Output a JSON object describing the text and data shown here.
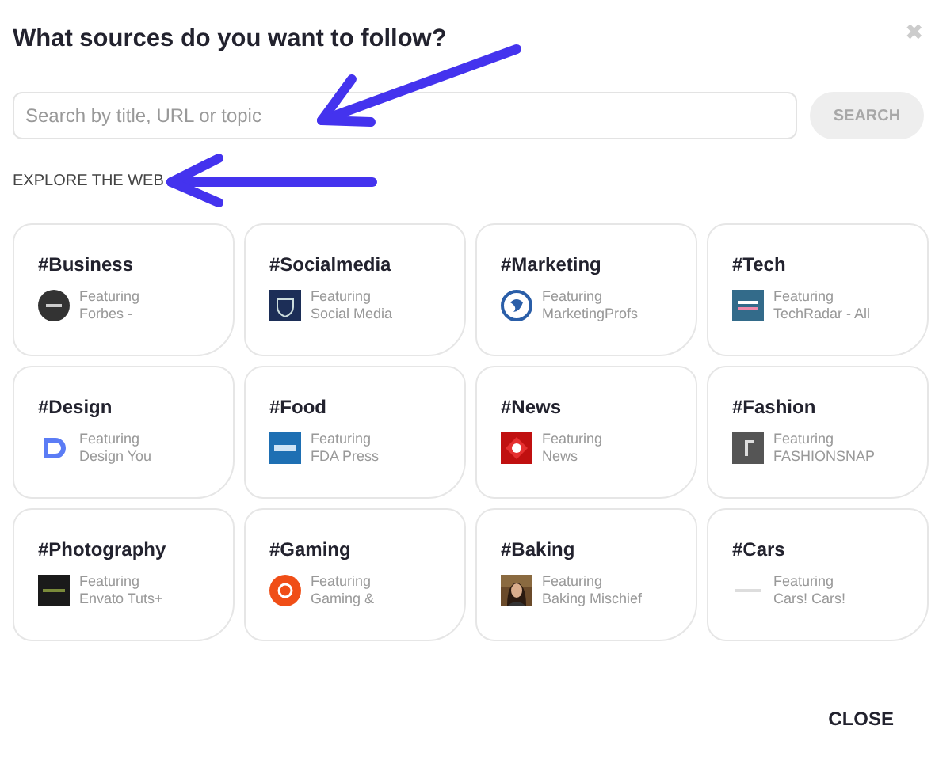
{
  "dialog": {
    "title": "What sources do you want to follow?",
    "close_icon": "✖"
  },
  "search": {
    "placeholder": "Search by title, URL or topic",
    "button": "SEARCH",
    "button_disabled": true
  },
  "section_label": "EXPLORE THE WEB",
  "topics": [
    {
      "tag": "#Business",
      "featuring": "Featuring",
      "source": "Forbes -",
      "logo": {
        "kind": "circle-dark"
      }
    },
    {
      "tag": "#Socialmedia",
      "featuring": "Featuring",
      "source": "Social Media",
      "logo": {
        "kind": "navy-shield"
      }
    },
    {
      "tag": "#Marketing",
      "featuring": "Featuring",
      "source": "MarketingProfs",
      "logo": {
        "kind": "globe"
      }
    },
    {
      "tag": "#Tech",
      "featuring": "Featuring",
      "source": "TechRadar - All",
      "logo": {
        "kind": "teal-square"
      }
    },
    {
      "tag": "#Design",
      "featuring": "Featuring",
      "source": "Design You",
      "logo": {
        "kind": "blue-d"
      }
    },
    {
      "tag": "#Food",
      "featuring": "Featuring",
      "source": "FDA Press",
      "logo": {
        "kind": "blue-square"
      }
    },
    {
      "tag": "#News",
      "featuring": "Featuring",
      "source": "News",
      "logo": {
        "kind": "red-diamond"
      }
    },
    {
      "tag": "#Fashion",
      "featuring": "Featuring",
      "source": "FASHIONSNAP",
      "logo": {
        "kind": "grey-square"
      }
    },
    {
      "tag": "#Photography",
      "featuring": "Featuring",
      "source": "Envato Tuts+",
      "logo": {
        "kind": "black-square"
      }
    },
    {
      "tag": "#Gaming",
      "featuring": "Featuring",
      "source": "Gaming &",
      "logo": {
        "kind": "orange-circle"
      }
    },
    {
      "tag": "#Baking",
      "featuring": "Featuring",
      "source": "Baking Mischief"
    },
    {
      "tag": "#Cars",
      "featuring": "Featuring",
      "source": "Cars! Cars!",
      "logo": {
        "kind": "faint-line"
      }
    }
  ],
  "footer": {
    "close": "CLOSE"
  }
}
